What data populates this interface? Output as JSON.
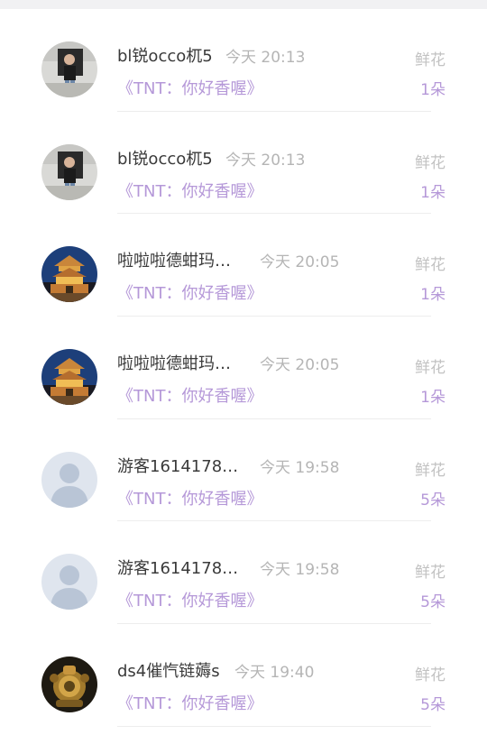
{
  "rows": [
    {
      "name": "bl锐occo杌5",
      "time": "今天 20:13",
      "quote": "《TNT：你好香喔》",
      "gift": "鲜花",
      "count": "1朵",
      "avatar": "photo-person-icon"
    },
    {
      "name": "bl锐occo杌5",
      "time": "今天 20:13",
      "quote": "《TNT：你好香喔》",
      "gift": "鲜花",
      "count": "1朵",
      "avatar": "photo-person-icon"
    },
    {
      "name": "啦啦啦德蚶玛…",
      "time": "今天 20:05",
      "quote": "《TNT：你好香喔》",
      "gift": "鲜花",
      "count": "1朵",
      "avatar": "tower-night-icon"
    },
    {
      "name": "啦啦啦德蚶玛…",
      "time": "今天 20:05",
      "quote": "《TNT：你好香喔》",
      "gift": "鲜花",
      "count": "1朵",
      "avatar": "tower-night-icon"
    },
    {
      "name": "游客1614178…",
      "time": "今天 19:58",
      "quote": "《TNT：你好香喔》",
      "gift": "鲜花",
      "count": "5朵",
      "avatar": "default-user-icon"
    },
    {
      "name": "游客1614178…",
      "time": "今天 19:58",
      "quote": "《TNT：你好香喔》",
      "gift": "鲜花",
      "count": "5朵",
      "avatar": "default-user-icon"
    },
    {
      "name": "ds4催忾链薅s",
      "time": "今天 19:40",
      "quote": "《TNT：你好香喔》",
      "gift": "鲜花",
      "count": "5朵",
      "avatar": "golden-robot-icon"
    }
  ],
  "colors": {
    "accent": "#b598d8",
    "name": "#3a3a3a",
    "muted": "#b5b5b5"
  }
}
